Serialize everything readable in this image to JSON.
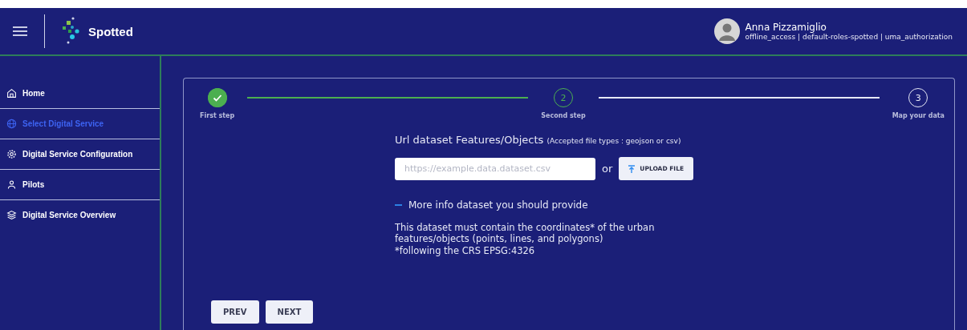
{
  "header": {
    "brand": "Spotted",
    "user": {
      "name": "Anna Pizzamiglio",
      "roles": "offline_access | default-roles-spotted | uma_authorization"
    }
  },
  "sidebar": {
    "items": [
      {
        "label": "Home",
        "selected": false
      },
      {
        "label": "Select Digital Service",
        "selected": true
      },
      {
        "label": "Digital Service Configuration",
        "selected": false
      },
      {
        "label": "Pilots",
        "selected": false
      },
      {
        "label": "Digital Service Overview",
        "selected": false
      }
    ]
  },
  "stepper": {
    "steps": [
      {
        "label": "First step",
        "kind": "done"
      },
      {
        "number": "2",
        "label": "Second step",
        "kind": "current"
      },
      {
        "number": "3",
        "label": "Map your data",
        "kind": "pending"
      }
    ]
  },
  "form": {
    "title": "Url dataset Features/Objects",
    "hint": "(Accepted file types : geojson or csv)",
    "url_field": {
      "placeholder": "https://example.data.dataset.csv"
    },
    "or": "or",
    "upload_button": "UPLOAD FILE",
    "info_toggle": {
      "label": "More info dataset you should provide"
    },
    "info_text": "This dataset must contain the coordinates* of the urban features/objects (points, lines, and polygons)",
    "info_note": "*following the CRS EPSG:4326"
  },
  "buttons": [
    "PREV",
    "NEXT"
  ]
}
